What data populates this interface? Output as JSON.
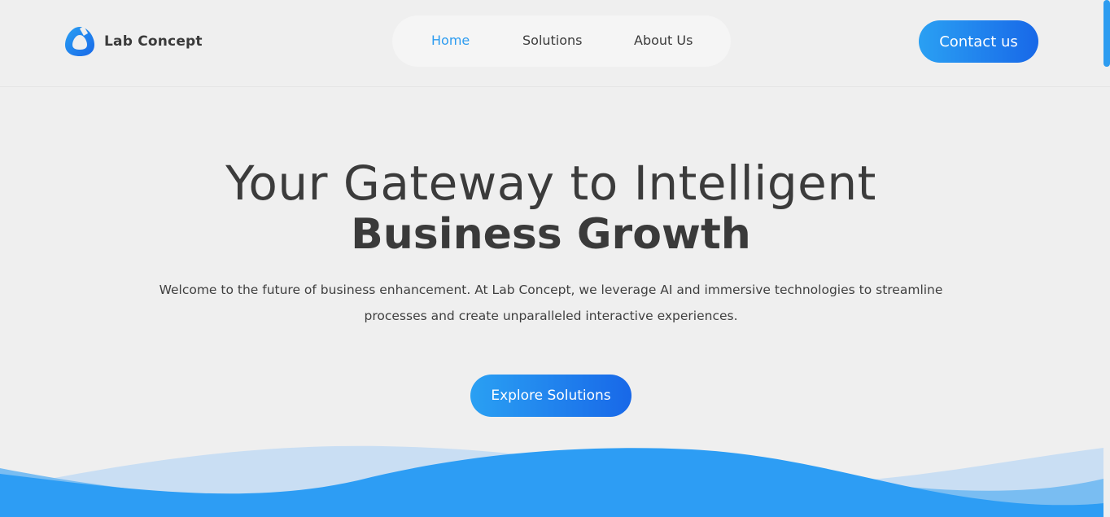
{
  "brand": {
    "name": "Lab Concept",
    "logo_icon": "lab-concept-logo-icon",
    "accent_color": "#2d9cf0",
    "gradient_start": "#2aa0f3",
    "gradient_end": "#1868e8"
  },
  "nav": {
    "items": [
      {
        "label": "Home",
        "active": true
      },
      {
        "label": "Solutions",
        "active": false
      },
      {
        "label": "About Us",
        "active": false
      }
    ]
  },
  "header": {
    "contact_label": "Contact us"
  },
  "hero": {
    "title_line1": "Your Gateway to Intelligent",
    "title_line2": "Business Growth",
    "description": "Welcome to the future of business enhancement. At Lab Concept, we leverage AI and immersive technologies to streamline processes and create unparalleled interactive experiences.",
    "cta_label": "Explore Solutions"
  },
  "decor": {
    "wave_colors": [
      "#c9def3",
      "#79bdf2",
      "#2d9df4"
    ]
  }
}
